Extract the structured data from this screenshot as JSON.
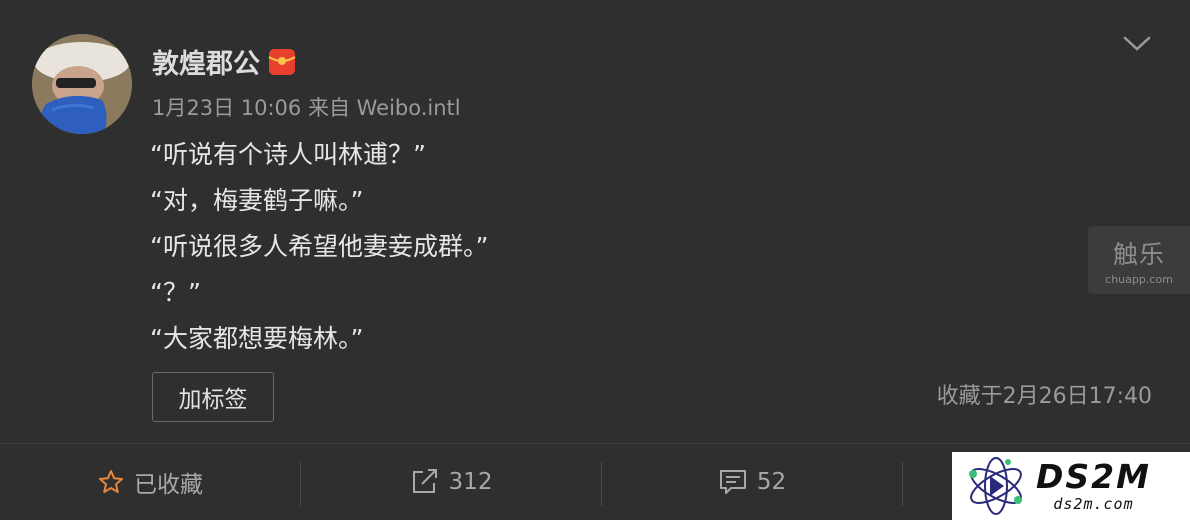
{
  "post": {
    "username": "敦煌郡公",
    "meta": "1月23日 10:06 来自 Weibo.intl",
    "lines": [
      "“听说有个诗人叫林逋？”",
      "“对，梅妻鹤子嘛。”",
      "“听说很多人希望他妻妾成群。”",
      "“？”",
      "“大家都想要梅林。”"
    ],
    "tag_button": "加标签",
    "collected_time": "收藏于2月26日17:40"
  },
  "icons": {
    "menu": "chevron-down-icon",
    "badge": "red-packet-icon",
    "favorite": "star-icon",
    "repost": "share-icon",
    "comment": "comment-icon"
  },
  "actions": {
    "favorite_label": "已收藏",
    "repost_count": "312",
    "comment_count": "52"
  },
  "watermarks": {
    "chuapp_big": "触乐",
    "chuapp_small": "chuapp.com",
    "ds2m_main": "DS2M",
    "ds2m_sub": "ds2m.com"
  },
  "colors": {
    "background": "#2f2f30",
    "favorite_accent": "#e8873a",
    "badge_red": "#e8402c"
  }
}
